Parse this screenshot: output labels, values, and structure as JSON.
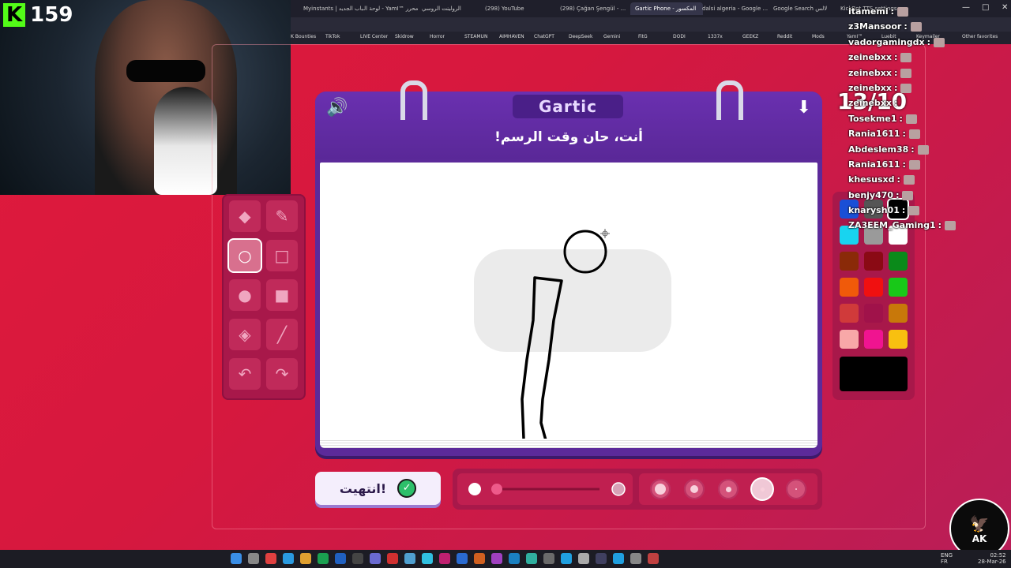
{
  "browser": {
    "tabs": [
      {
        "label": "Myinstants | باب الجديد"
      },
      {
        "label": "لوحة الـ - YamI™ محرر"
      },
      {
        "label": "الرولينت الروسي"
      },
      {
        "label": "(298) YouTube"
      },
      {
        "label": "(298) Çağan Şengül - ..."
      },
      {
        "label": "Gartic Phone - المكسور"
      },
      {
        "label": "dalsi algeria - Google ..."
      },
      {
        "label": "Google Search لالس"
      },
      {
        "label": "KickBot TTS settings"
      }
    ],
    "active_tab_index": 5,
    "bookmarks": [
      "K Bounties",
      "TikTok",
      "LIVE Center",
      "Skidrow",
      "Horror",
      "STEAMUN",
      "AIMHAVEN",
      "ChatGPT",
      "DeepSeek",
      "Gemini",
      "FitG",
      "DODI",
      "1337x",
      "GEEKZ",
      "Reddit",
      "Mods",
      "YamI™",
      "Luebit",
      "Keymailer",
      "Other favorites"
    ]
  },
  "webcam": {
    "viewer_count": "159",
    "platform_logo": "K"
  },
  "game": {
    "logo": "Gartic",
    "prompt": "أنت، حان وقت الرسم!",
    "done_label": "انتهيت!",
    "tools": [
      {
        "name": "eraser",
        "glyph": "◆"
      },
      {
        "name": "pencil",
        "glyph": "✎"
      },
      {
        "name": "circle-outline",
        "glyph": "○",
        "selected": true
      },
      {
        "name": "square-outline",
        "glyph": "□"
      },
      {
        "name": "circle-filled",
        "glyph": "●"
      },
      {
        "name": "square-filled",
        "glyph": "■"
      },
      {
        "name": "fill-bucket",
        "glyph": "◈"
      },
      {
        "name": "line",
        "glyph": "╱"
      },
      {
        "name": "undo",
        "glyph": "↶"
      },
      {
        "name": "redo",
        "glyph": "↷"
      }
    ],
    "colors": [
      "#1a4fd6",
      "#555555",
      "#000000",
      "#18d4f0",
      "#9a9a9a",
      "#ffffff",
      "#8a2a08",
      "#8a0a14",
      "#0a8a1a",
      "#f05a0a",
      "#f01010",
      "#18c818",
      "#d03a3a",
      "#a0124a",
      "#c8780a",
      "#f8a8a8",
      "#f01490",
      "#f8c010"
    ],
    "selected_color": "#000000",
    "opacity": 0.35,
    "brush_sizes": 5,
    "selected_brush_index": 3,
    "accent": "#5c2a9a"
  },
  "chat": {
    "round_counter": "13/10",
    "messages": [
      {
        "user": "itamemi",
        "emote": true
      },
      {
        "user": "z3Mansoor",
        "emote": true
      },
      {
        "user": "vadorgamingdx",
        "emote": true
      },
      {
        "user": "zeinebxx",
        "emote": true
      },
      {
        "user": "zeinebxx",
        "emote": true
      },
      {
        "user": "zeinebxx",
        "emote": true
      },
      {
        "user": "zeinebxx",
        "emote": false
      },
      {
        "user": "Tosekme1",
        "emote": true
      },
      {
        "user": "Rania1611",
        "emote": true
      },
      {
        "user": "Abdeslem38",
        "emote": true
      },
      {
        "user": "Rania1611",
        "emote": true
      },
      {
        "user": "khesusxd",
        "emote": true
      },
      {
        "user": "benjy470",
        "emote": true
      },
      {
        "user": "knarysh01",
        "emote": true
      },
      {
        "user": "ZA3EEM_Gaming1",
        "emote": true
      }
    ]
  },
  "taskbar": {
    "lang": "ENG",
    "region": "FR",
    "time": "02:52",
    "date": "28-Mar-26"
  },
  "streamer_logo": "AK"
}
